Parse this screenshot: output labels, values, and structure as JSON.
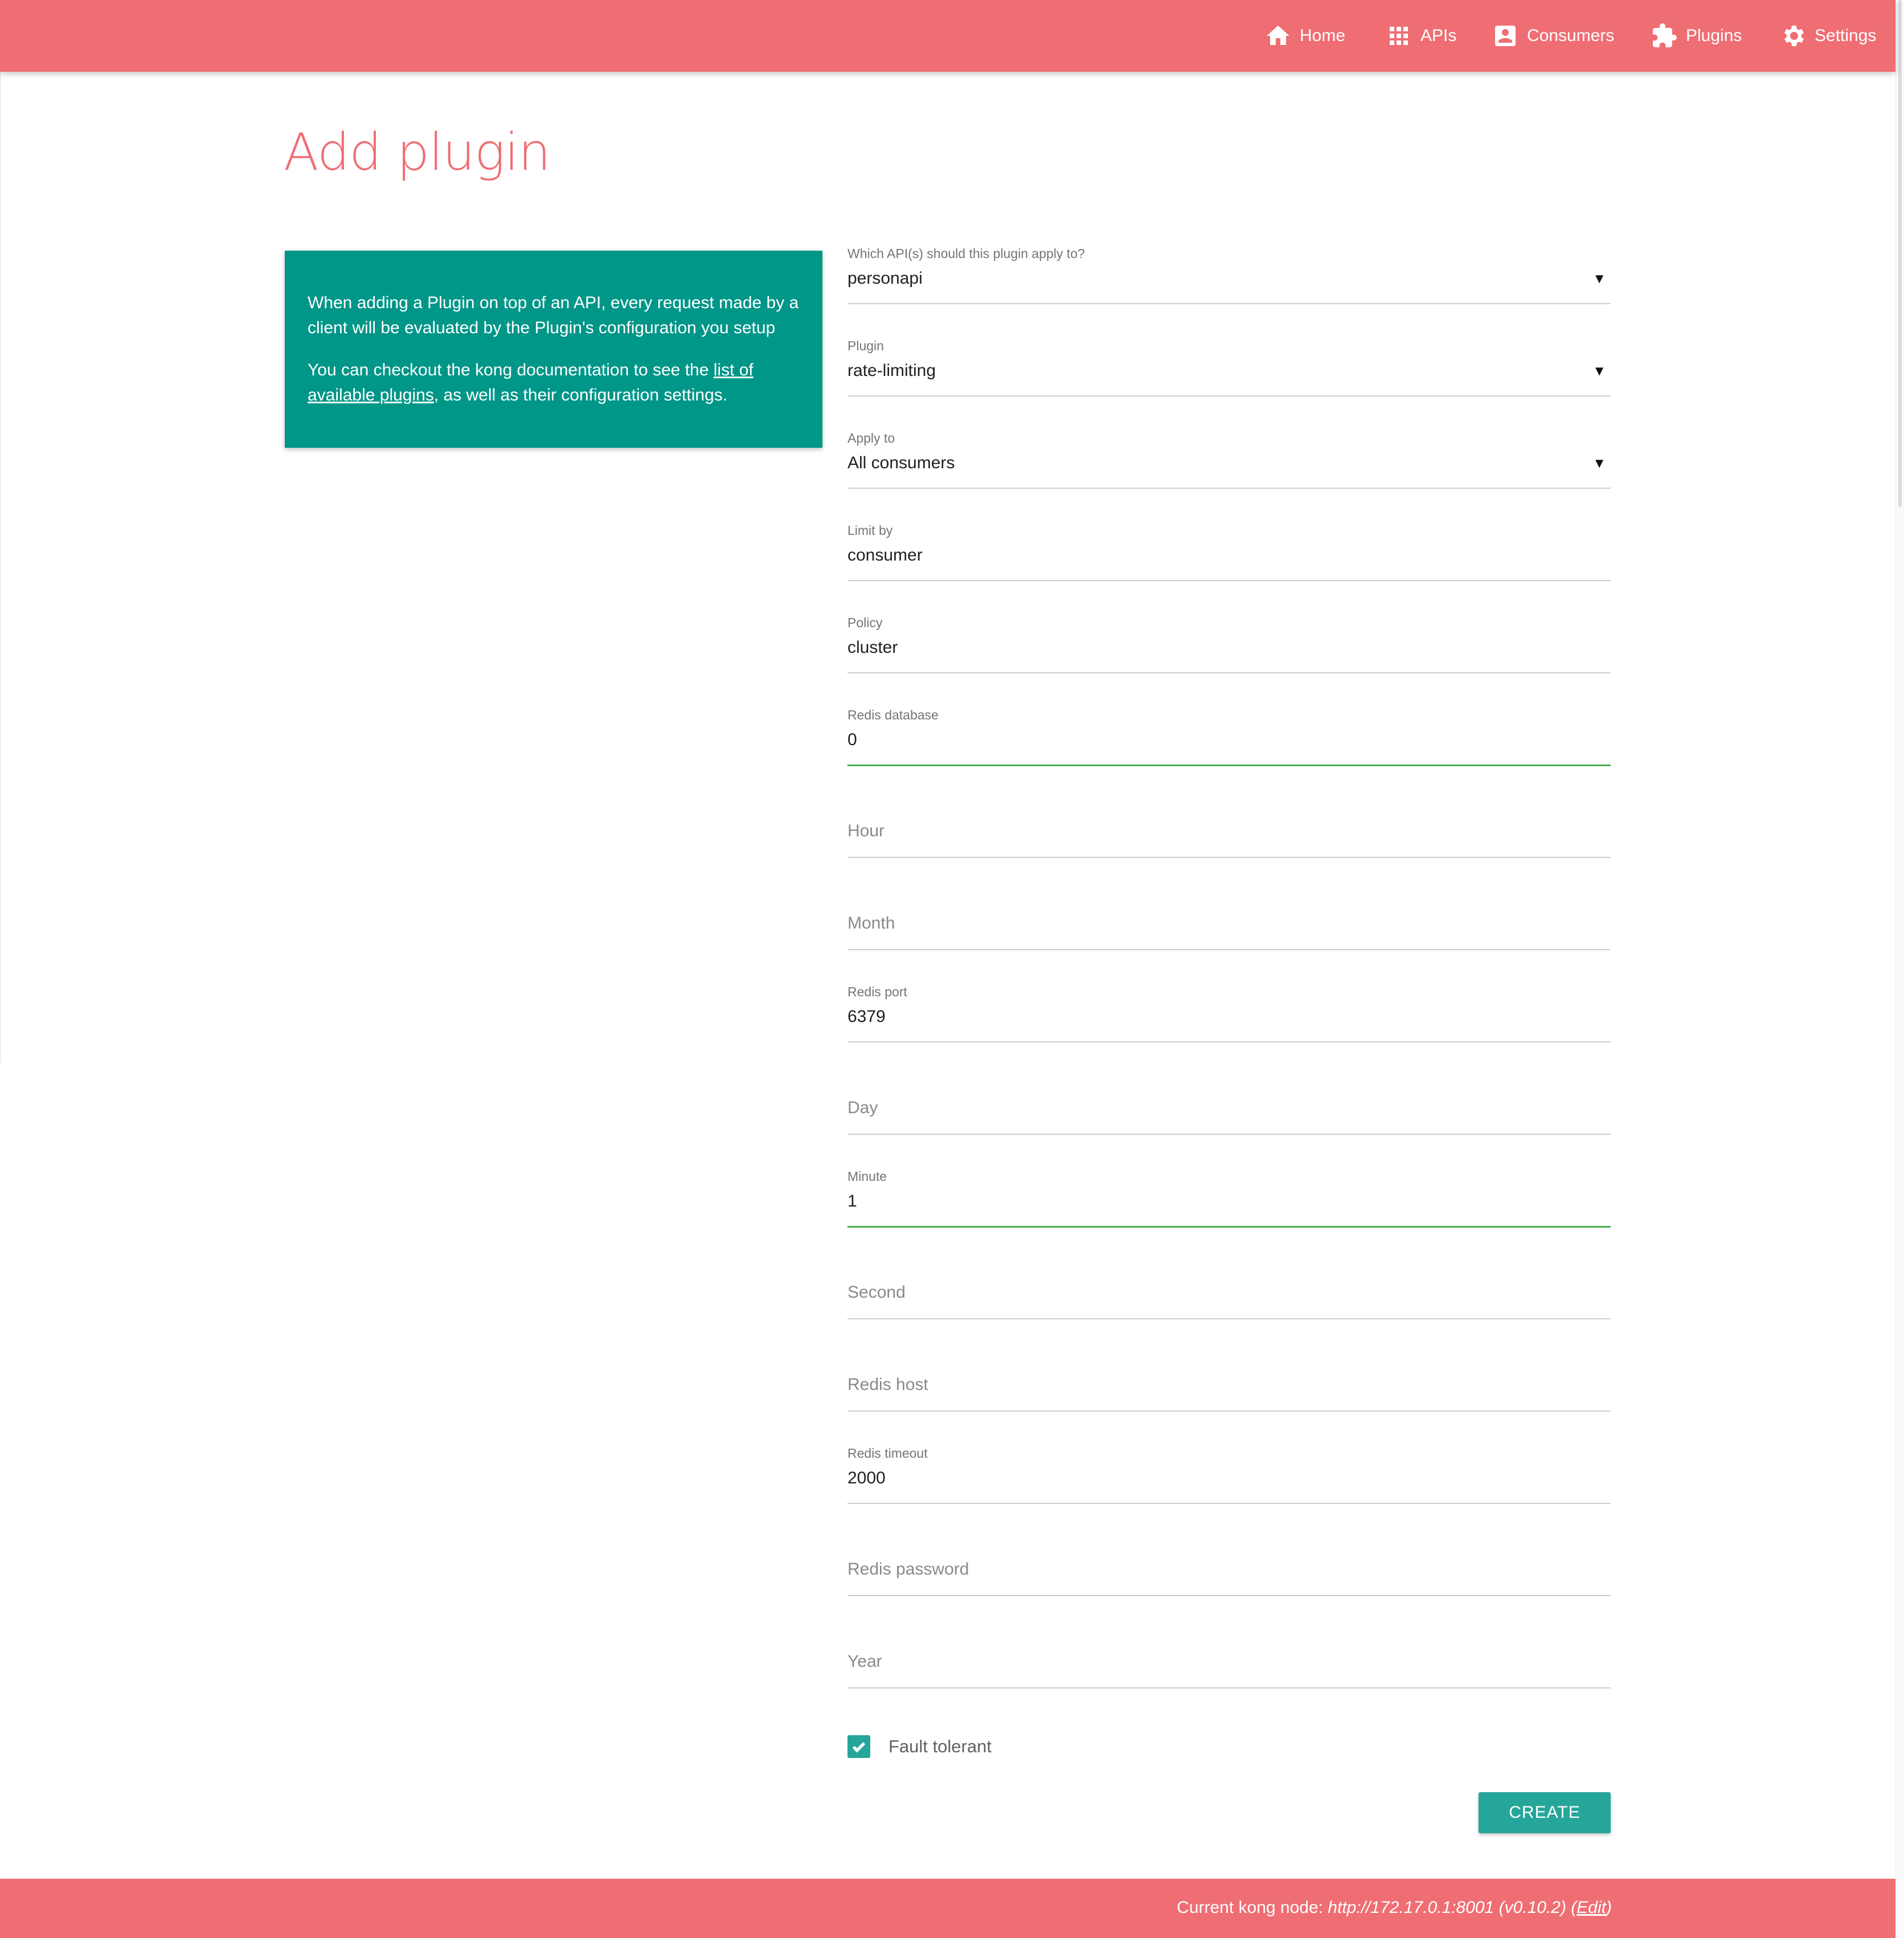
{
  "nav": {
    "home": "Home",
    "apis": "APIs",
    "consumers": "Consumers",
    "plugins": "Plugins",
    "settings": "Settings"
  },
  "page_title": "Add plugin",
  "info": {
    "p1": "When adding a Plugin on top of an API, every request made by a client will be evaluated by the Plugin's configuration you setup",
    "p2_prefix": "You can checkout the kong documentation to see the ",
    "p2_link": "list of available plugins",
    "p2_suffix": ", as well as their configuration settings."
  },
  "form": {
    "api": {
      "label": "Which API(s) should this plugin apply to?",
      "value": "personapi"
    },
    "plugin": {
      "label": "Plugin",
      "value": "rate-limiting"
    },
    "apply_to": {
      "label": "Apply to",
      "value": "All consumers"
    },
    "limit_by": {
      "label": "Limit by",
      "value": "consumer"
    },
    "policy": {
      "label": "Policy",
      "value": "cluster"
    },
    "redis_database": {
      "label": "Redis database",
      "value": "0"
    },
    "hour": {
      "placeholder": "Hour"
    },
    "month": {
      "placeholder": "Month"
    },
    "redis_port": {
      "label": "Redis port",
      "value": "6379"
    },
    "day": {
      "placeholder": "Day"
    },
    "minute": {
      "label": "Minute",
      "value": "1"
    },
    "second": {
      "placeholder": "Second"
    },
    "redis_host": {
      "placeholder": "Redis host"
    },
    "redis_timeout": {
      "label": "Redis timeout",
      "value": "2000"
    },
    "redis_password": {
      "placeholder": "Redis password"
    },
    "year": {
      "placeholder": "Year"
    },
    "fault_tolerant": {
      "label": "Fault tolerant",
      "checked": true
    },
    "create_button": "CREATE"
  },
  "footer": {
    "prefix": "Current kong node: ",
    "node": "http://172.17.0.1:8001 (v0.10.2)",
    "open_paren": " (",
    "edit": "Edit",
    "close_paren": ")"
  },
  "colors": {
    "brand": "#ef6e73",
    "teal": "#009688",
    "accent": "#26a69a",
    "focus_underline": "#4caf50"
  }
}
